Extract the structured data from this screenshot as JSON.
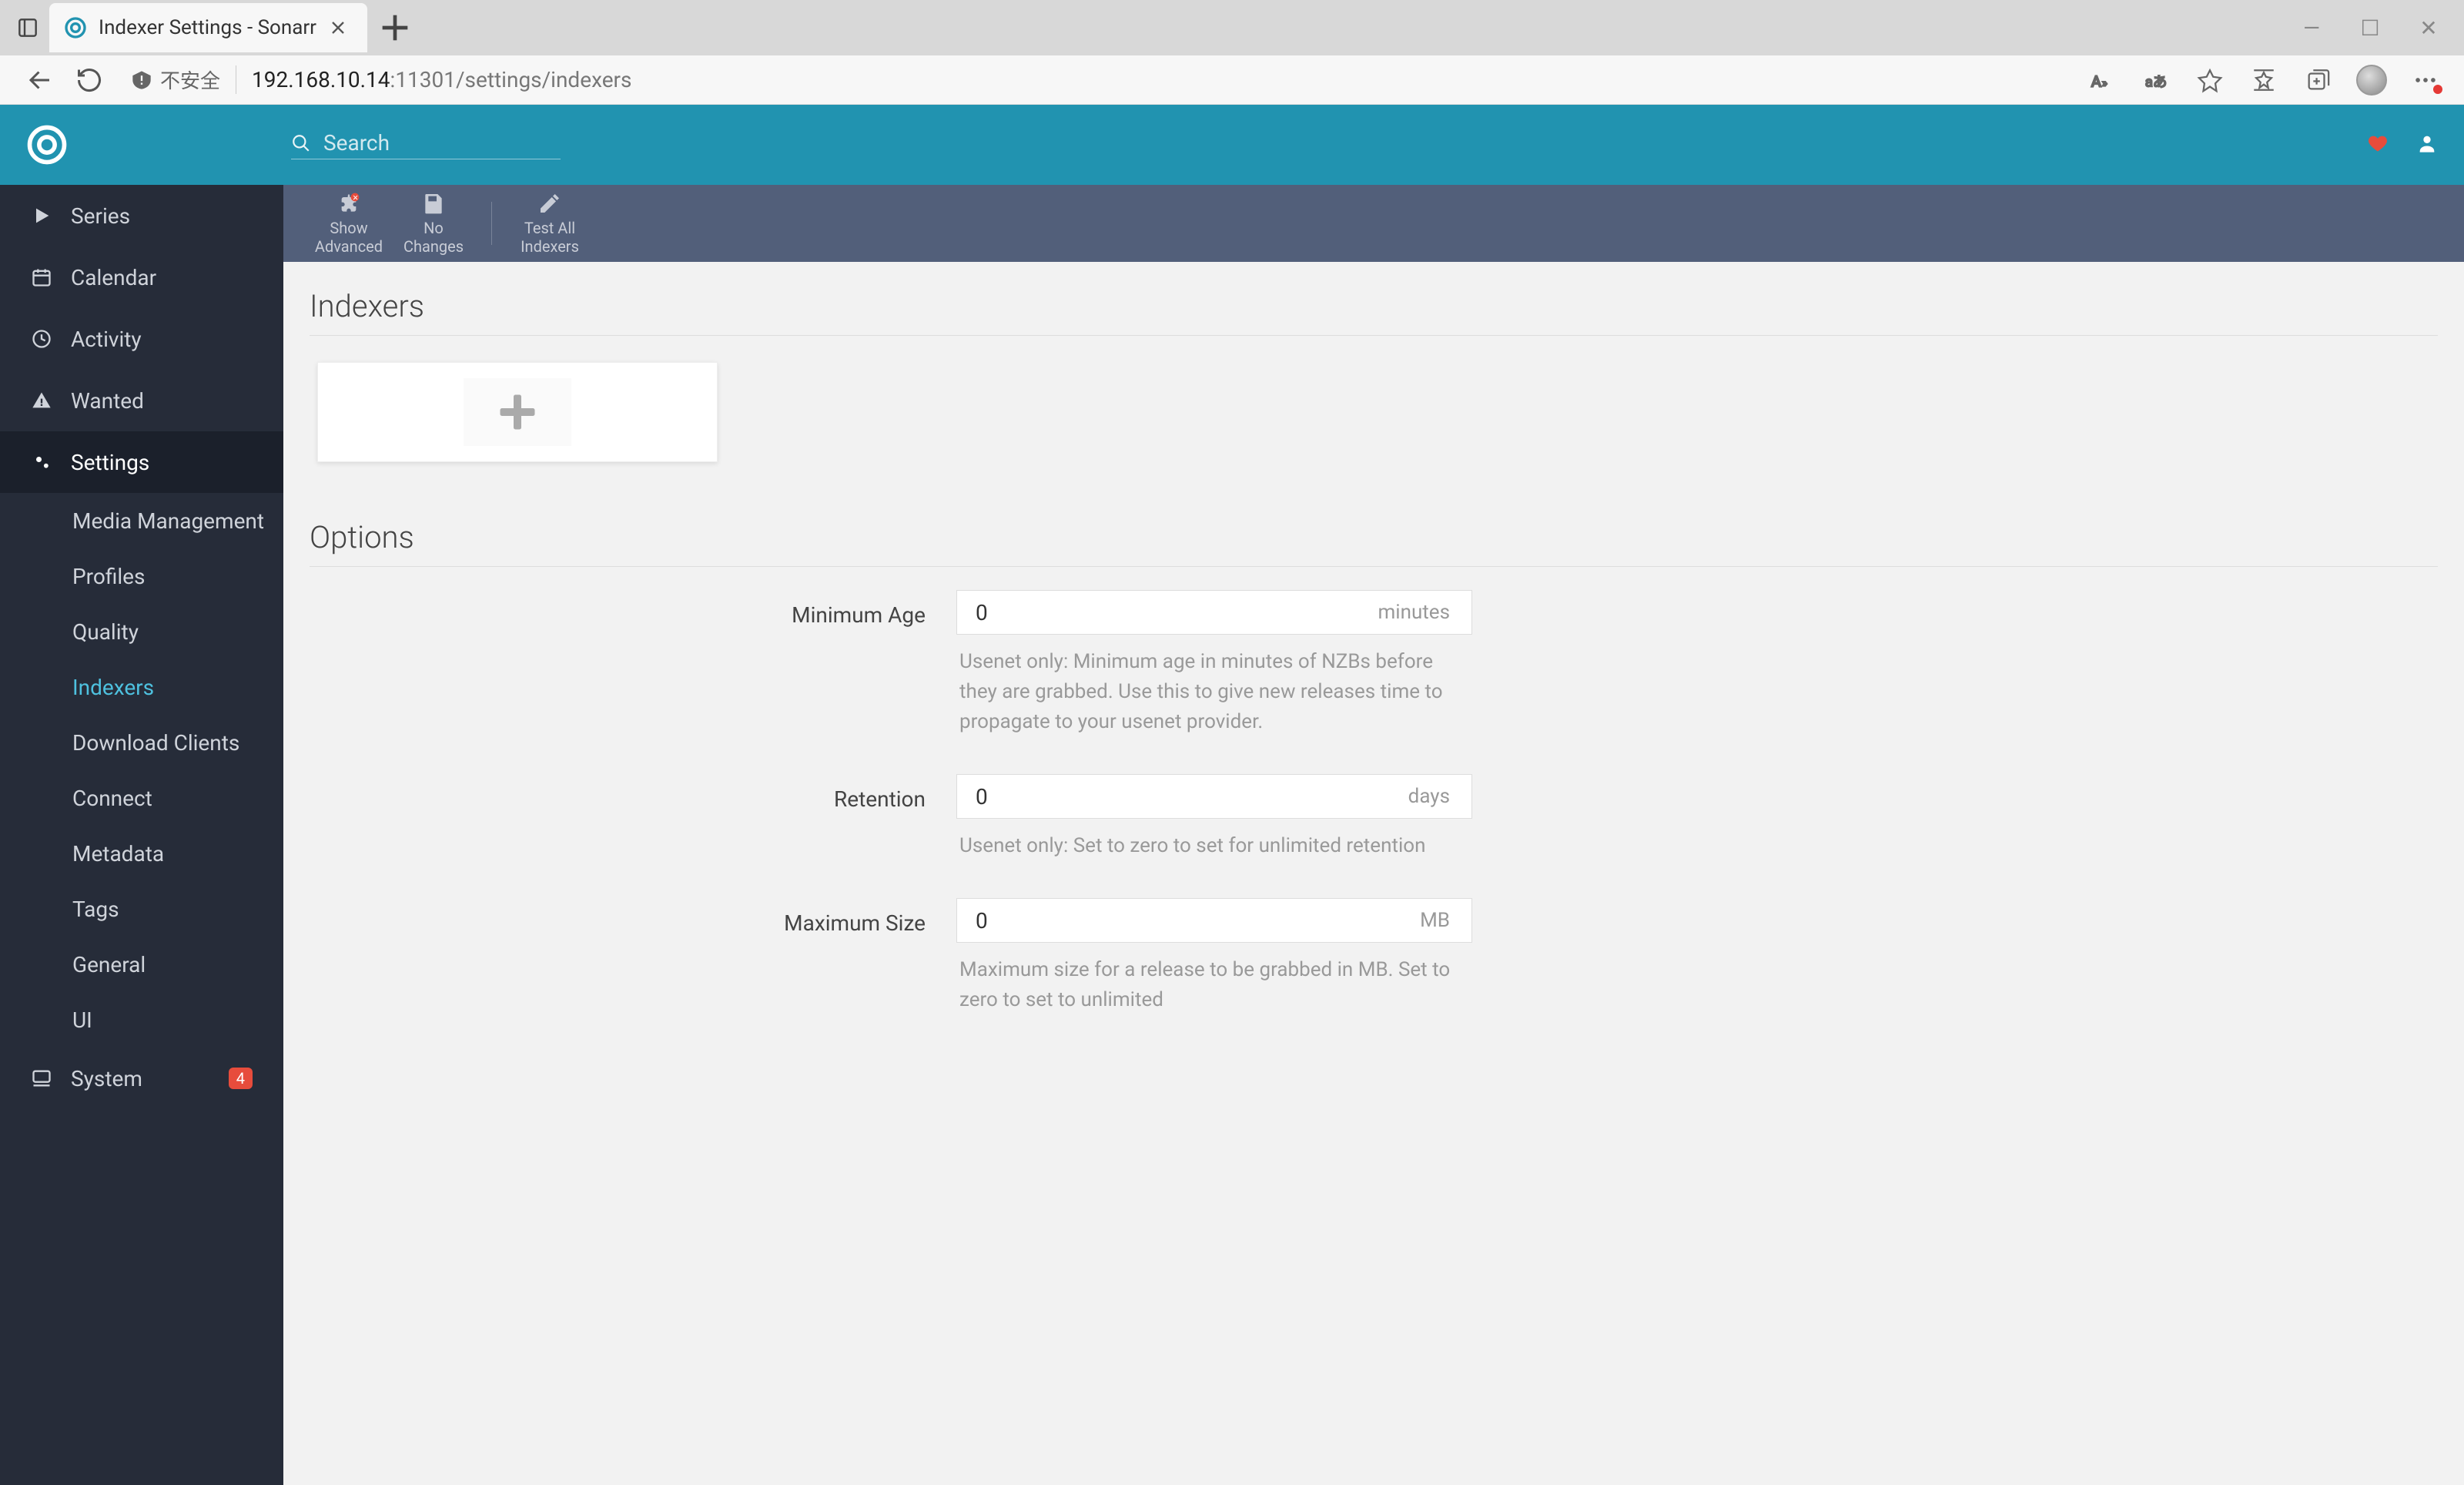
{
  "browser": {
    "tab_title": "Indexer Settings - Sonarr",
    "security_label": "不安全",
    "url_host": "192.168.10.14",
    "url_path": ":11301/settings/indexers"
  },
  "header": {
    "search_placeholder": "Search"
  },
  "sidebar": {
    "series": "Series",
    "calendar": "Calendar",
    "activity": "Activity",
    "wanted": "Wanted",
    "settings": "Settings",
    "subs": {
      "media": "Media Management",
      "profiles": "Profiles",
      "quality": "Quality",
      "indexers": "Indexers",
      "download": "Download Clients",
      "connect": "Connect",
      "metadata": "Metadata",
      "tags": "Tags",
      "general": "General",
      "ui": "UI"
    },
    "system": "System",
    "system_badge": "4"
  },
  "toolbar": {
    "advanced_l1": "Show",
    "advanced_l2": "Advanced",
    "changes_l1": "No",
    "changes_l2": "Changes",
    "test_l1": "Test All",
    "test_l2": "Indexers"
  },
  "page": {
    "indexers_title": "Indexers",
    "options_title": "Options",
    "min_age": {
      "label": "Minimum Age",
      "value": "0",
      "unit": "minutes",
      "help": "Usenet only: Minimum age in minutes of NZBs before they are grabbed. Use this to give new releases time to propagate to your usenet provider."
    },
    "retention": {
      "label": "Retention",
      "value": "0",
      "unit": "days",
      "help": "Usenet only: Set to zero to set for unlimited retention"
    },
    "max_size": {
      "label": "Maximum Size",
      "value": "0",
      "unit": "MB",
      "help": "Maximum size for a release to be grabbed in MB. Set to zero to set to unlimited"
    }
  }
}
